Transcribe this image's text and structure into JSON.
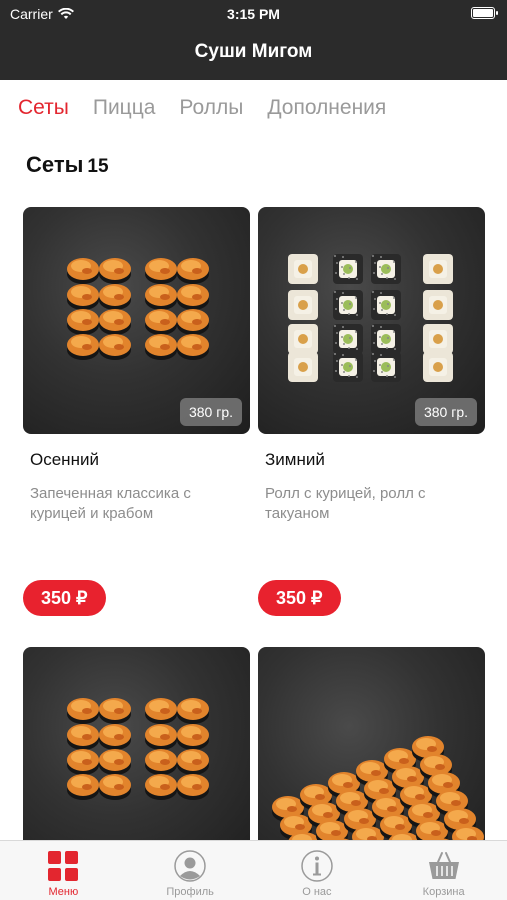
{
  "status_bar": {
    "carrier": "Carrier",
    "time": "3:15 PM"
  },
  "header": {
    "title": "Суши Мигом"
  },
  "categories": [
    {
      "label": "Сеты",
      "active": true
    },
    {
      "label": "Пицца",
      "active": false
    },
    {
      "label": "Роллы",
      "active": false
    },
    {
      "label": "Дополнения",
      "active": false
    }
  ],
  "section": {
    "title": "Сеты",
    "count": "15"
  },
  "products": [
    {
      "name": "Осенний",
      "description": "Запеченная классика с курицей и крабом",
      "weight": "380 гр.",
      "price": "350 ₽",
      "photo_style": "baked"
    },
    {
      "name": "Зимний",
      "description": "Ролл с курицей, ролл с такуаном",
      "weight": "380 гр.",
      "price": "350 ₽",
      "photo_style": "mixed"
    },
    {
      "photo_style": "baked"
    },
    {
      "photo_style": "baked-many"
    }
  ],
  "tab_bar": {
    "items": [
      {
        "label": "Меню",
        "icon": "grid-icon",
        "active": true
      },
      {
        "label": "Профиль",
        "icon": "profile-icon",
        "active": false
      },
      {
        "label": "О нас",
        "icon": "info-icon",
        "active": false
      },
      {
        "label": "Корзина",
        "icon": "basket-icon",
        "active": false
      }
    ]
  },
  "colors": {
    "accent": "#e3262f",
    "price_button": "#e8222e",
    "header_bg": "#2b2b2b",
    "muted": "#9a9a9a"
  }
}
